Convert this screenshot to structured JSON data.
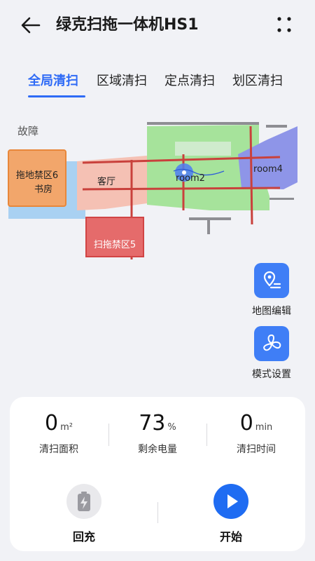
{
  "header": {
    "title": "绿克扫拖一体机HS1"
  },
  "tabs": [
    {
      "label": "全局清扫",
      "active": true
    },
    {
      "label": "区域清扫",
      "active": false
    },
    {
      "label": "定点清扫",
      "active": false
    },
    {
      "label": "划区清扫",
      "active": false
    }
  ],
  "map": {
    "fault_label": "故障",
    "rooms": {
      "study": "书房",
      "living": "客厅",
      "room2": "room2",
      "room4": "room4"
    },
    "zones": {
      "mop_forbidden": "拖地禁区6",
      "sweep_mop_forbidden": "扫拖禁区5"
    }
  },
  "side_tools": {
    "map_edit": "地图编辑",
    "mode_settings": "模式设置"
  },
  "stats": {
    "area": {
      "value": "0",
      "unit": "m²",
      "label": "清扫面积"
    },
    "battery": {
      "value": "73",
      "unit": "%",
      "label": "剩余电量"
    },
    "time": {
      "value": "0",
      "unit": "min",
      "label": "清扫时间"
    }
  },
  "actions": {
    "recharge": "回充",
    "start": "开始"
  },
  "colors": {
    "accent": "#2f6bf6",
    "tool_bg": "#3f7ef6",
    "start_btn": "#1f6cf2",
    "recharge_btn": "#e9e9ec"
  }
}
